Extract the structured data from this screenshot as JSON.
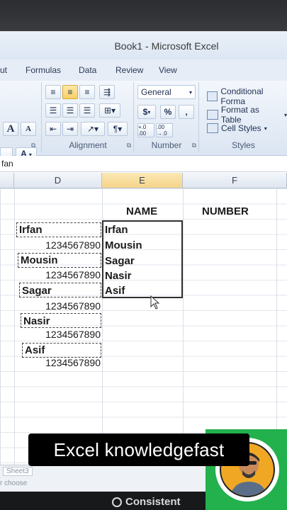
{
  "window": {
    "title": "Book1 - Microsoft Excel"
  },
  "menu": {
    "tabs": [
      "ut",
      "Formulas",
      "Data",
      "Review",
      "View"
    ]
  },
  "ribbon": {
    "font_grow": "A",
    "font_shrink": "A",
    "font_color_glyph": "A",
    "alignment_label": "Alignment",
    "number_format": "General",
    "currency": "$",
    "percent": "%",
    "comma": ",",
    "inc_decimal": "+.0 .00",
    "dec_decimal": ".00 →.0",
    "number_label": "Number",
    "conditional_formatting": "Conditional Forma",
    "format_as_table": "Format as Table",
    "cell_styles": "Cell Styles",
    "styles_label": "Styles"
  },
  "formula_bar": {
    "content": "fan"
  },
  "columns": [
    "D",
    "E",
    "F"
  ],
  "sheet": {
    "header_name": "NAME",
    "header_number": "NUMBER",
    "column_d": [
      {
        "name": "Irfan",
        "number": "1234567890"
      },
      {
        "name": "Mousin",
        "number": "1234567890"
      },
      {
        "name": "Sagar",
        "number": "1234567890"
      },
      {
        "name": "Nasir",
        "number": "1234567890"
      },
      {
        "name": "Asif",
        "number": "1234567890"
      }
    ],
    "column_e": [
      "Irfan",
      "Mousin",
      "Sagar",
      "Nasir",
      "Asif"
    ]
  },
  "sheet_tabs": {
    "tab": "Sheet3",
    "hint": "r choose"
  },
  "overlay": {
    "caption": "Excel knowledgefast"
  },
  "monitor": {
    "brand": "Consistent"
  }
}
